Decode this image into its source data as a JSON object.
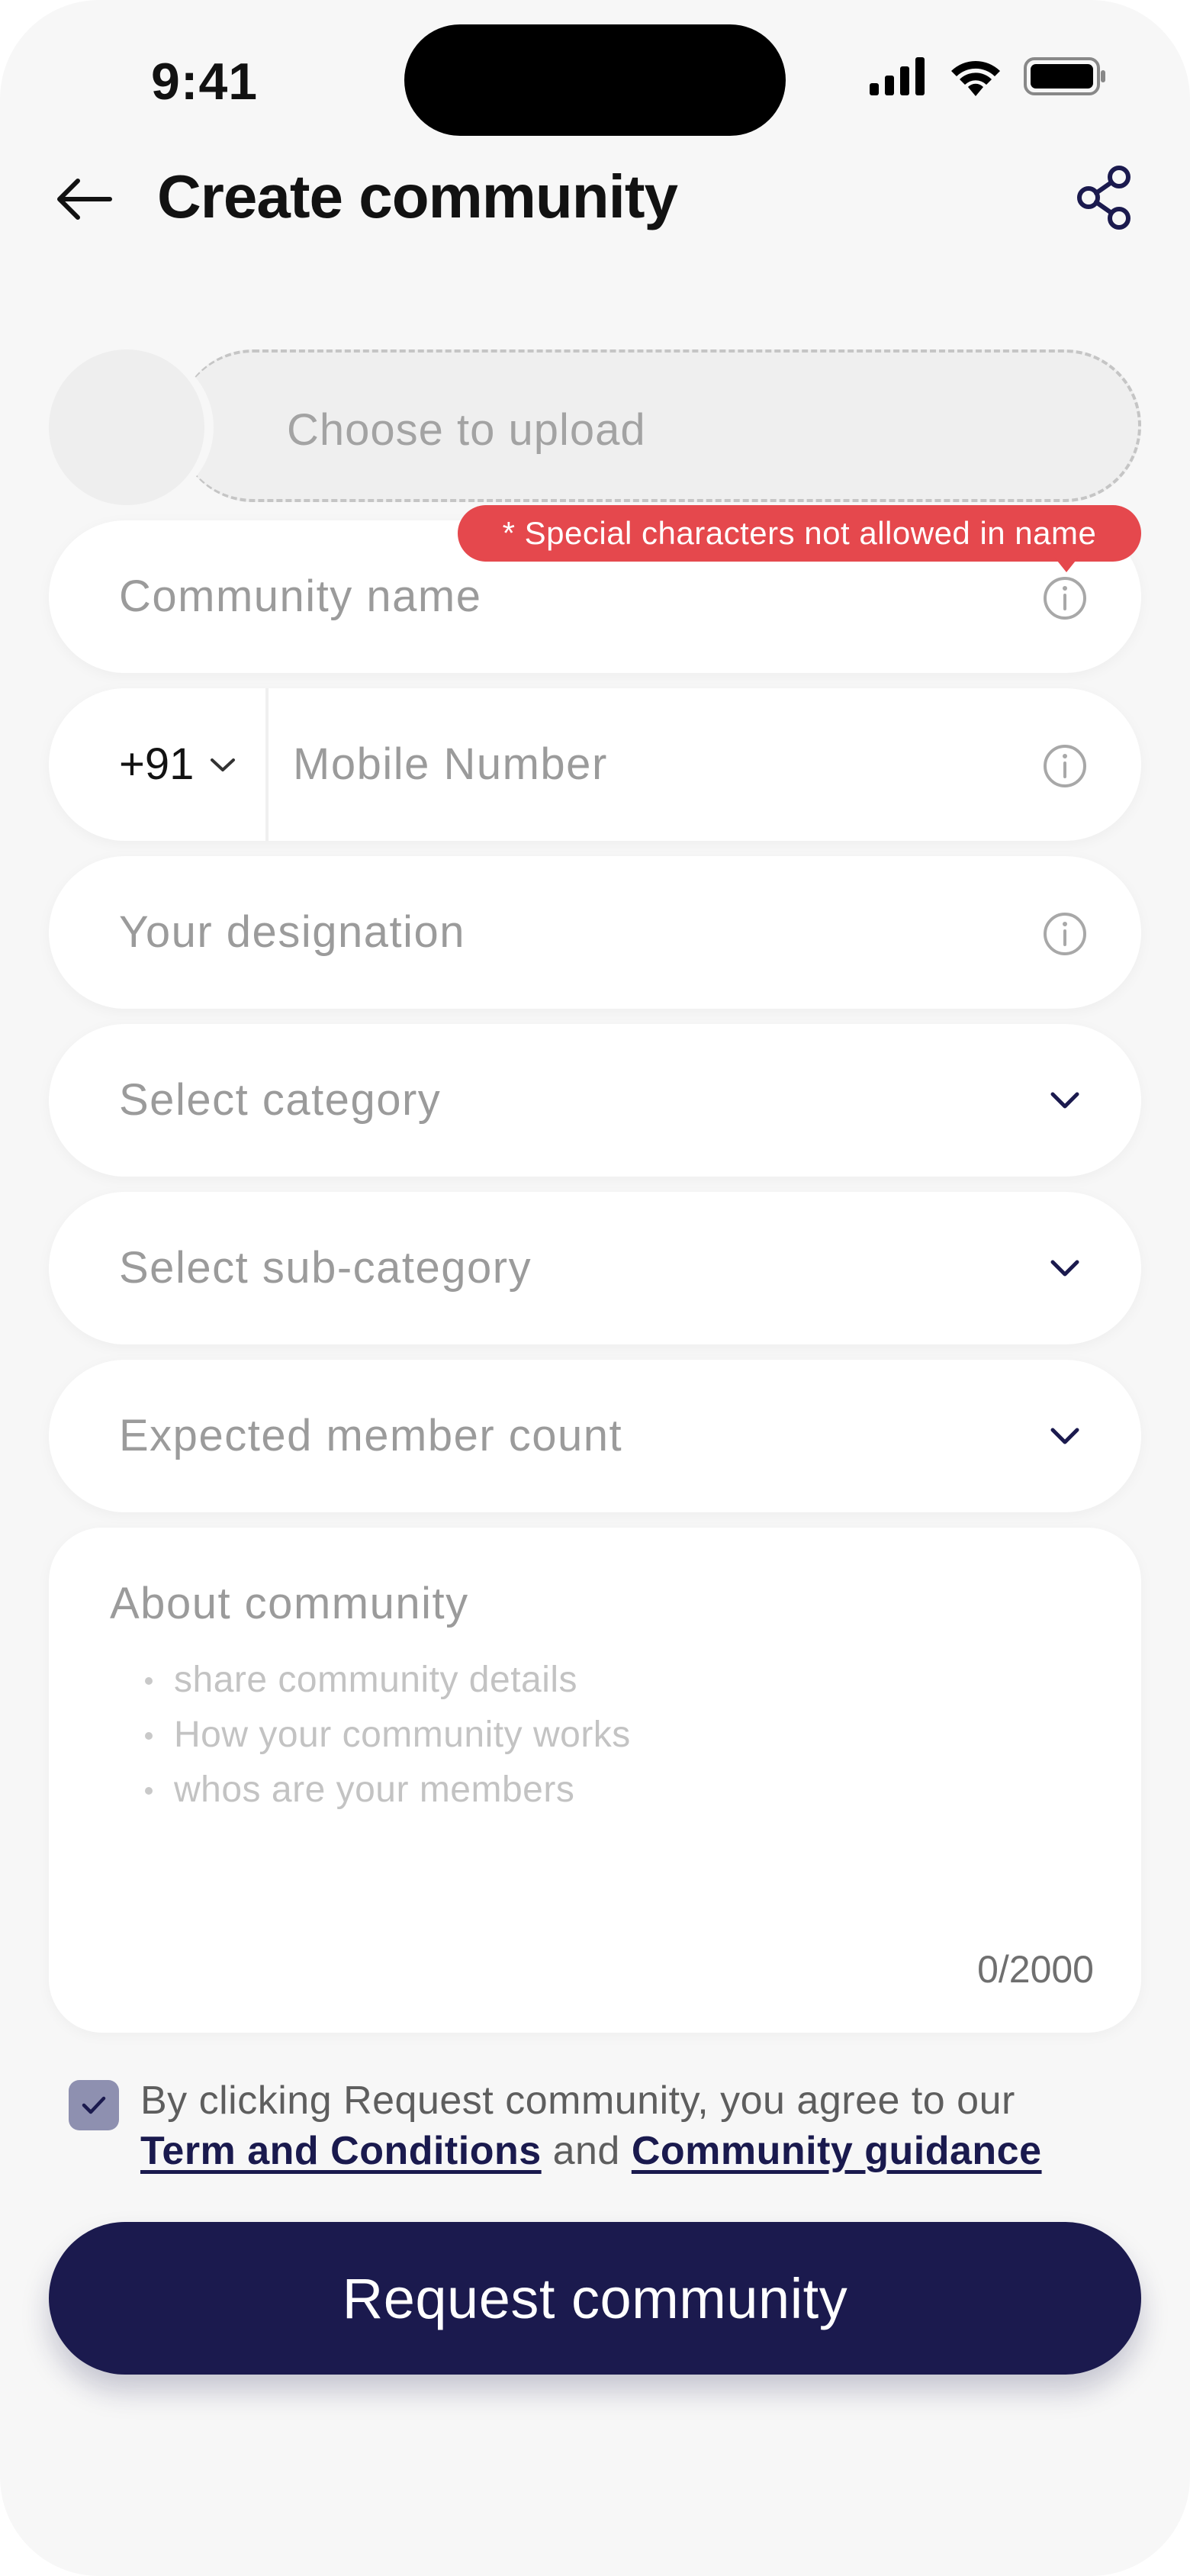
{
  "status_bar": {
    "time": "9:41",
    "icons": [
      "cellular-signal-icon",
      "wifi-icon",
      "battery-icon"
    ]
  },
  "header": {
    "title": "Create community",
    "back_icon": "arrow-left-icon",
    "share_icon": "share-icon"
  },
  "upload": {
    "placeholder": "Choose to upload"
  },
  "form": {
    "community_name": {
      "placeholder": "Community name",
      "error": "* Special characters not allowed in name"
    },
    "mobile": {
      "country_code": "+91",
      "placeholder": "Mobile Number"
    },
    "designation": {
      "placeholder": "Your designation"
    },
    "category": {
      "placeholder": "Select category"
    },
    "sub_category": {
      "placeholder": "Select sub-category"
    },
    "member_count": {
      "placeholder": "Expected member count"
    },
    "about": {
      "label": "About community",
      "hints": [
        "share community details",
        "How your community works",
        "whos are your members"
      ],
      "counter": "0/2000"
    }
  },
  "terms": {
    "checked": true,
    "prefix": "By clicking Request community, you agree to our",
    "link1": "Term and Conditions",
    "conjunction": "and",
    "link2": "Community guidance"
  },
  "primary_button": {
    "label": "Request community"
  },
  "colors": {
    "primary": "#1b1a4e",
    "error": "#e5484d",
    "checkbox": "#8e90b0",
    "background": "#f7f7f7"
  }
}
